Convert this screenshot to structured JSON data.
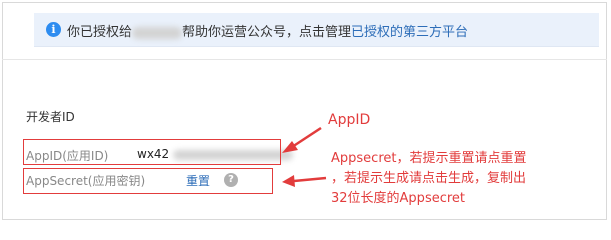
{
  "notice": {
    "prefix": "你已授权给",
    "suffix": "帮助你运营公众号，点击管理",
    "link": "已授权的第三方平台"
  },
  "developer": {
    "section_title": "开发者ID",
    "appid_label": "AppID(应用ID)",
    "appid_value": "wx42",
    "secret_label": "AppSecret(应用密钥)",
    "reset_link": "重置",
    "help_glyph": "?"
  },
  "annotations": {
    "appid_note": "AppID",
    "secret_note_lines": [
      "Appsecret，若提示重置请点重置",
      "，若提示生成请点击生成，复制出",
      "32位长度的Appsecret"
    ]
  },
  "colors": {
    "accent_blue": "#2d6db8",
    "annotation_red": "#e23c3c",
    "notice_bg": "#eaf1fb"
  },
  "icons": [
    "info-icon",
    "help-icon",
    "arrow-icon"
  ]
}
